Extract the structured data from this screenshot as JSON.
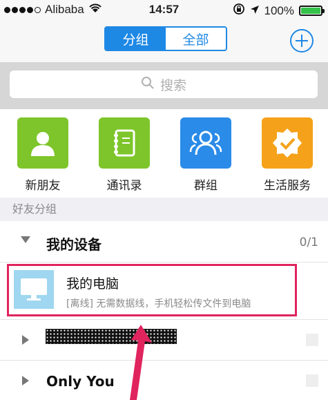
{
  "status": {
    "carrier": "Alibaba",
    "time": "14:57",
    "battery": "100%",
    "battery_level": 1.0
  },
  "nav": {
    "tab_groups": "分组",
    "tab_all": "全部",
    "selected_tab": "分组"
  },
  "search": {
    "placeholder": "搜索"
  },
  "functions": [
    {
      "label": "新朋友",
      "icon": "person-icon",
      "color": "#7dc52a"
    },
    {
      "label": "通讯录",
      "icon": "address-book-icon",
      "color": "#7dc52a"
    },
    {
      "label": "群组",
      "icon": "group-icon",
      "color": "#2a8be8"
    },
    {
      "label": "生活服务",
      "icon": "service-badge-icon",
      "color": "#f5a21a"
    }
  ],
  "section_header": "好友分组",
  "groups": [
    {
      "name": "我的设备",
      "count": "0/1",
      "expanded": true
    },
    {
      "name": "",
      "count": "",
      "expanded": false,
      "name_redacted": true
    },
    {
      "name": "Only You",
      "count": "",
      "expanded": false
    }
  ],
  "device": {
    "name": "我的电脑",
    "description": "[离线] 无需数据线，手机轻松传文件到电脑"
  },
  "colors": {
    "accent": "#1e88e5",
    "highlight": "#e0245e"
  }
}
